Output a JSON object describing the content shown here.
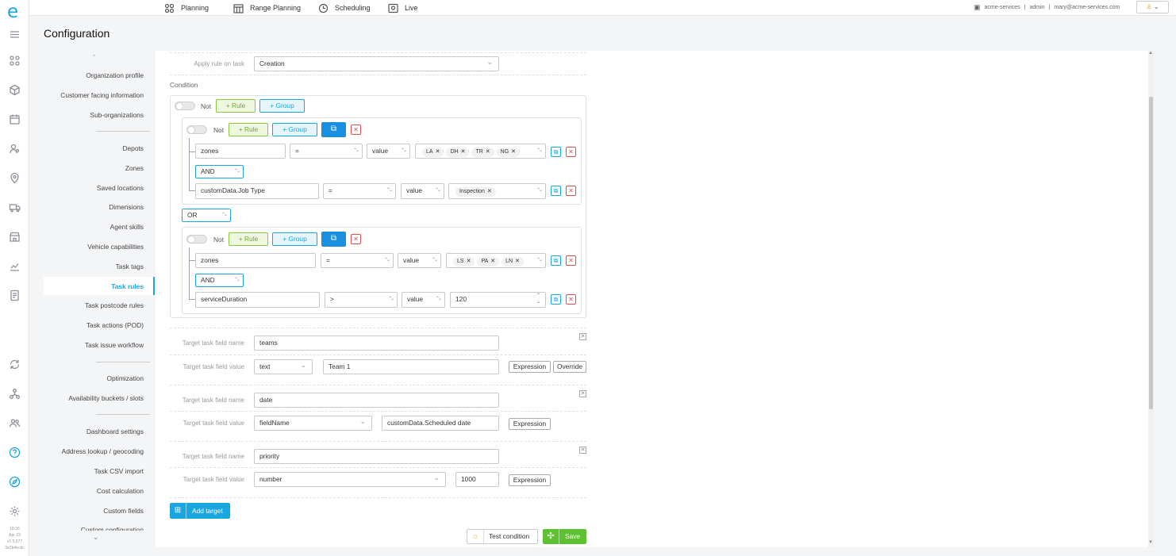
{
  "topbar": {
    "nav": [
      "Planning",
      "Range Planning",
      "Scheduling",
      "Live"
    ],
    "org": "acme-services",
    "role": "admin",
    "email": "mary@acme-services.com"
  },
  "page_title": "Configuration",
  "sidebar": {
    "items": [
      "Organization profile",
      "Customer facing information",
      "Sub-organizations",
      "Depots",
      "Zones",
      "Saved locations",
      "Dimensions",
      "Agent skills",
      "Vehicle capabilities",
      "Task tags",
      "Task rules",
      "Task postcode rules",
      "Task actions (POD)",
      "Task issue workflow",
      "Optimization",
      "Availability buckets / slots",
      "Dashboard settings",
      "Address lookup / geocoding",
      "Task CSV import",
      "Cost calculation",
      "Custom fields",
      "Custom configuration"
    ],
    "active": "Task rules"
  },
  "version": {
    "time": "18:36",
    "date": "Apr 23",
    "version": "v1.0.577",
    "build": "3e2b4ecdc"
  },
  "rule": {
    "apply_label": "Apply rule on task",
    "apply_value": "Creation",
    "condition_label": "Condition",
    "not_label": "Not",
    "add_rule": "+ Rule",
    "add_group": "+ Group",
    "or_value": "OR",
    "group1": {
      "row1": {
        "field": "zones",
        "op": "=",
        "type": "value",
        "tags": [
          "LA",
          "DH",
          "TR",
          "NG"
        ]
      },
      "join": "AND",
      "row2": {
        "field": "customData.Job Type",
        "op": "=",
        "type": "value",
        "tags": [
          "Inspection"
        ]
      }
    },
    "group2": {
      "row1": {
        "field": "zones",
        "op": "=",
        "type": "value",
        "tags": [
          "LS",
          "PA",
          "LN"
        ]
      },
      "join": "AND",
      "row2": {
        "field": "serviceDuration",
        "op": ">",
        "type": "value",
        "number": "120"
      }
    }
  },
  "targets": {
    "name_label": "Target task field name",
    "value_label": "Target task field value",
    "expression": "Expression",
    "override": "Override",
    "items": [
      {
        "name": "teams",
        "type": "text",
        "value": "Team 1"
      },
      {
        "name": "date",
        "type": "fieldName",
        "value": "customData.Scheduled date"
      },
      {
        "name": "priority",
        "type": "number",
        "value": "1000"
      }
    ]
  },
  "buttons": {
    "add_target": "Add target",
    "test_condition": "Test condition",
    "save": "Save"
  },
  "colors": {
    "accent": "#1aa6e0",
    "save": "#5dc132",
    "danger": "#e05050"
  }
}
